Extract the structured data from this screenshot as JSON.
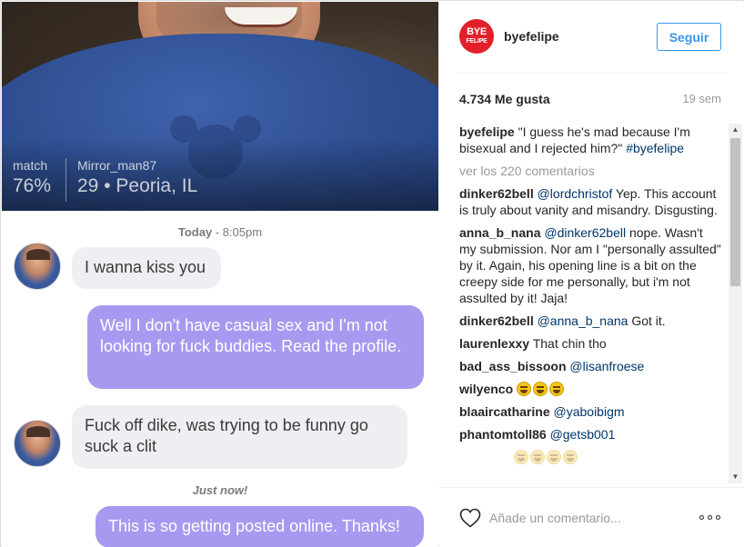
{
  "post_image": {
    "profile": {
      "match_label": "match",
      "match_value": "76%",
      "username": "Mirror_man87",
      "info": "29 • Peoria, IL"
    },
    "chat": {
      "timestamp_day": "Today",
      "timestamp_time": " - 8:05pm",
      "timestamp_now": "Just now!",
      "messages": [
        {
          "side": "in",
          "text": "I wanna kiss you"
        },
        {
          "side": "out",
          "text": "Well I don't have casual sex and I'm not looking for fuck buddies. Read the profile."
        },
        {
          "side": "in",
          "text": "Fuck off dike, was trying to be funny go suck a clit"
        },
        {
          "side": "out",
          "text": "This is so getting posted online. Thanks!"
        }
      ]
    }
  },
  "header": {
    "logo_line1": "BYE",
    "logo_line2": "FELIPE",
    "username": "byefelipe",
    "follow_label": "Seguir"
  },
  "stats": {
    "likes": "4.734 Me gusta",
    "time_ago": "19 sem"
  },
  "caption": {
    "author": "byefelipe",
    "text": " \"I guess he's mad because I'm bisexual and I rejected him?\" ",
    "hashtag": "#byefelipe"
  },
  "view_all_label": "ver los 220 comentarios",
  "comments": [
    {
      "author": "dinker62bell",
      "mention": "@lordchristof",
      "text": " Yep. This account is truly about vanity and misandry. Disgusting."
    },
    {
      "author": "anna_b_nana",
      "mention": "@dinker62bell",
      "text": " nope. Wasn't my submission. Nor am I \"personally assulted\" by it. Again, his opening line is a bit on the creepy side for me personally, but i'm not assulted by it! Jaja!"
    },
    {
      "author": "dinker62bell",
      "mention": "@anna_b_nana",
      "text": " Got it."
    },
    {
      "author": "laurenlexxy",
      "mention": "",
      "text": " That chin tho"
    },
    {
      "author": "bad_ass_bissoon",
      "mention": "@lisanfroese",
      "text": ""
    },
    {
      "author": "wilyenco",
      "mention": "",
      "text": "",
      "emoji_count": 3,
      "emoji": "laughing-crying-emoji"
    },
    {
      "author": "blaaircatharine",
      "mention": "@yaboibigm",
      "text": ""
    },
    {
      "author": "phantomtoll86",
      "mention": "@getsb001",
      "text": ""
    }
  ],
  "comment_bar": {
    "placeholder": "Añade un comentario..."
  },
  "colors": {
    "brand_red": "#e2202b",
    "follow_blue": "#3897f0",
    "outgoing_bubble": "#a899f0",
    "incoming_bubble": "#eeeff3",
    "mention_blue": "#003569"
  },
  "icons": {
    "like": "heart-icon",
    "more": "more-options-icon",
    "scroll_up": "scroll-up-arrow-icon",
    "scroll_down": "scroll-down-arrow-icon"
  }
}
